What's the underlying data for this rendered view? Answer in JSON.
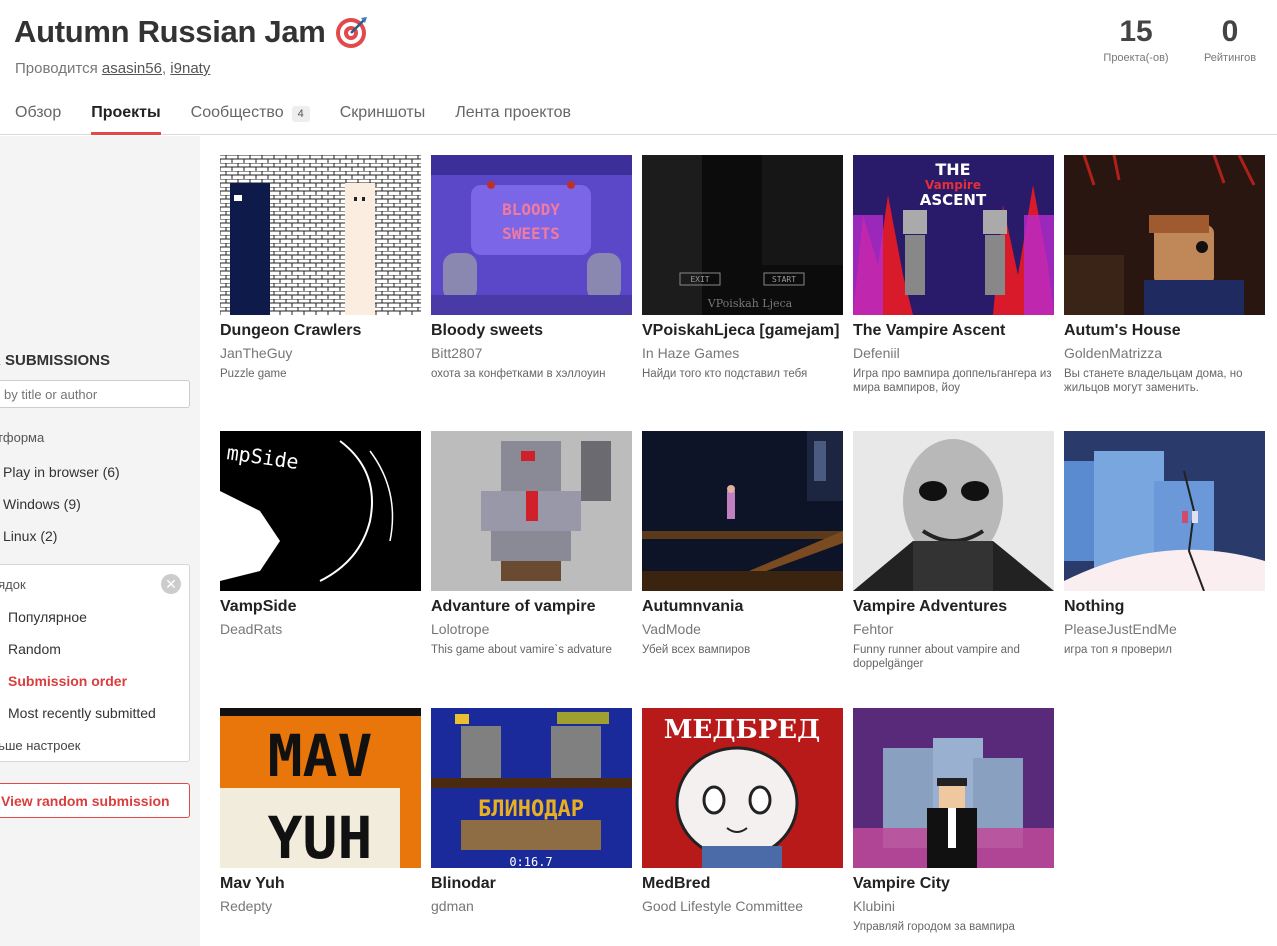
{
  "header": {
    "title": "Autumn Russian Jam",
    "hosted_prefix": "Проводится",
    "hosts": [
      "asasin56",
      "i9naty"
    ],
    "stats": [
      {
        "value": "15",
        "label": "Проекта(-ов)"
      },
      {
        "value": "0",
        "label": "Рейтингов"
      }
    ],
    "tabs": [
      {
        "label": "Обзор",
        "count": null
      },
      {
        "label": "Проекты",
        "count": null
      },
      {
        "label": "Сообщество",
        "count": "4"
      },
      {
        "label": "Скриншоты",
        "count": null
      },
      {
        "label": "Лента проектов",
        "count": null
      }
    ]
  },
  "sidebar": {
    "filter_title": "R SUBMISSIONS",
    "search_placeholder": "by title or author",
    "platform_title": "атформа",
    "platforms": [
      "Play in browser (6)",
      "Windows (9)",
      "Linux (2)"
    ],
    "sort_title": "рядок",
    "sort_options": [
      "Популярное",
      "Random",
      "Submission order",
      "Most recently submitted"
    ],
    "sort_selected": "Submission order",
    "less_settings": "ньше настроек",
    "random_button": "View random submission"
  },
  "submissions": [
    {
      "title": "Dungeon Crawlers",
      "author": "JanTheGuy",
      "description": "Puzzle game"
    },
    {
      "title": "Bloody sweets",
      "author": "Bitt2807",
      "description": "охота за конфетками в хэллоуин"
    },
    {
      "title": "VPoiskahLjeca [gamejam]",
      "author": "In Haze Games",
      "description": "Найди того кто подставил тебя"
    },
    {
      "title": "The Vampire Ascent",
      "author": "Defeniil",
      "description": "Игра про вампира доппельгангера из мира вампиров, йоу"
    },
    {
      "title": "Autum's House",
      "author": "GoldenMatrizza",
      "description": "Вы станете владельцам дома, но жильцов могут заменить."
    },
    {
      "title": "VampSide",
      "author": "DeadRats",
      "description": ""
    },
    {
      "title": "Advanture of vampire",
      "author": "Lolotrope",
      "description": "This game about vamire`s advature"
    },
    {
      "title": "Autumnvania",
      "author": "VadMode",
      "description": "Убей всех вампиров"
    },
    {
      "title": "Vampire Adventures",
      "author": "Fehtor",
      "description": "Funny runner about vampire and doppelgänger"
    },
    {
      "title": "Nothing",
      "author": "PleaseJustEndMe",
      "description": "игра топ я проверил"
    },
    {
      "title": "Mav Yuh",
      "author": "Redepty",
      "description": ""
    },
    {
      "title": "Blinodar",
      "author": "gdman",
      "description": ""
    },
    {
      "title": "MedBred",
      "author": "Good Lifestyle Committee",
      "description": ""
    },
    {
      "title": "Vampire City",
      "author": "Klubini",
      "description": "Управляй городом за вампира"
    }
  ],
  "thumbnail_text": {
    "bloody_sweets": "BLOODY SWEETS",
    "vpoisk_exit": "EXIT",
    "vpoisk_start": "START",
    "vpoisk_sign": "VPoiskah Ljeca",
    "vampire_ascent": "THE Vampire ASCENT",
    "vampside": "mpSide",
    "mav_yuh": "MAV YUH",
    "blinodar": "БЛИНОДАР",
    "blinodar_timer": "0:16.7",
    "medbred": "МЕДБРЕД"
  },
  "colors": {
    "accent": "#e04a4a",
    "sidebar_bg": "#f4f4f4"
  }
}
